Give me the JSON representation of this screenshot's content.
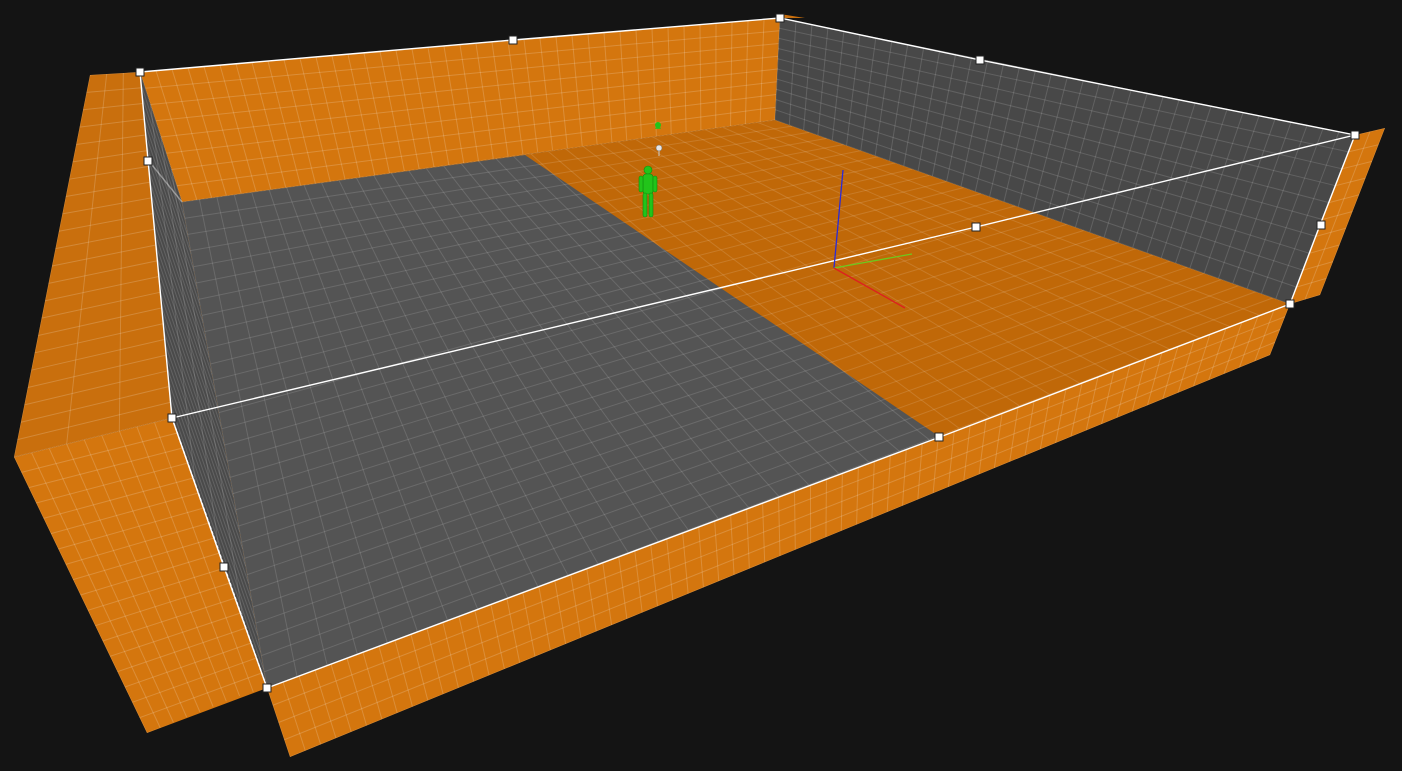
{
  "viewport": {
    "name": "3d-perspective-viewport",
    "background": "#141414"
  },
  "colors": {
    "background": "#141414",
    "wall_orange": "#d4760e",
    "wall_orange_dark": "#b86408",
    "wall_orange_side": "#c96f0d",
    "floor_orange": "#c06808",
    "floor_gray": "#535353",
    "wall_gray": "#4c4c4c",
    "wall_gray_dark": "#464646",
    "grid_line": "#ffffff",
    "selection_line": "#ffffff",
    "vertex_fill": "#ffffff",
    "vertex_stroke": "#222222",
    "player_green": "#22c41a",
    "axis_x": "#dd2020",
    "axis_y": "#6ec81e",
    "axis_z": "#2a2ad8"
  },
  "icons": {
    "player_start": "player-start-icon",
    "light": "light-icon",
    "spawn_marker": "spawn-marker-icon",
    "gizmo": "transform-gizmo-icon"
  }
}
